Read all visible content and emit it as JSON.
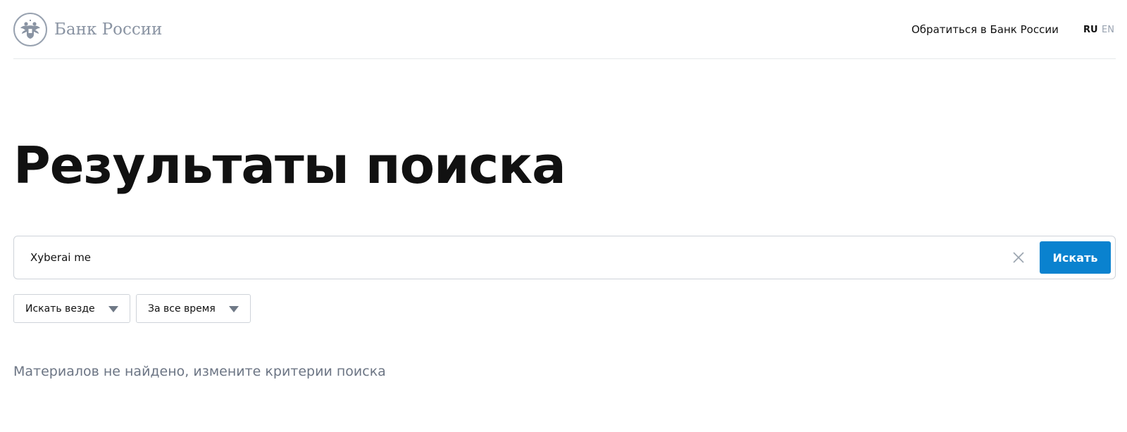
{
  "header": {
    "logo_text": "Банк России",
    "contact_link": "Обратиться в Банк России",
    "lang_ru": "RU",
    "lang_en": "EN",
    "logo_icon": "double-headed-eagle-icon"
  },
  "main": {
    "title": "Результаты поиска",
    "search": {
      "value": "Xyberai me",
      "clear_icon": "close-icon",
      "button_label": "Искать"
    },
    "filters": [
      {
        "label": "Искать везде",
        "icon": "triangle-down-icon"
      },
      {
        "label": "За все время",
        "icon": "triangle-down-icon"
      }
    ],
    "no_results_text": "Материалов не найдено, измените критерии поиска"
  },
  "colors": {
    "accent": "#0a82cf",
    "muted_text": "#6c7584",
    "logo_grey": "#8a94a3",
    "border": "#ced3d9"
  }
}
